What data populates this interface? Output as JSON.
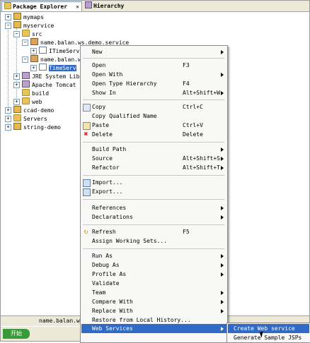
{
  "tabs": {
    "package_explorer": "Package Explorer",
    "hierarchy": "Hierarchy",
    "close": "✕"
  },
  "tree": {
    "mymaps": "mymaps",
    "myservice": "myservice",
    "src": "src",
    "pkg1": "name.balan.ws.demo.service",
    "file1": "ITimeServ",
    "pkg2": "name.balan.w",
    "file2": "TimeServ",
    "jre": "JRE System Libr",
    "tomcat": "Apache Tomcat v",
    "build": "build",
    "web": "web",
    "ccad": "ccad-demo",
    "servers": "Servers",
    "string": "string-demo"
  },
  "status": {
    "text": "name.balan.w",
    "start": "开始"
  },
  "menu": {
    "new": "New",
    "open": "Open",
    "open_acc": "F3",
    "open_with": "Open With",
    "open_type": "Open Type Hierarchy",
    "open_type_acc": "F4",
    "show_in": "Show In",
    "show_in_acc": "Alt+Shift+W",
    "copy": "Copy",
    "copy_acc": "Ctrl+C",
    "copy_q": "Copy Qualified Name",
    "paste": "Paste",
    "paste_acc": "Ctrl+V",
    "delete": "Delete",
    "delete_acc": "Delete",
    "build_path": "Build Path",
    "source": "Source",
    "source_acc": "Alt+Shift+S",
    "refactor": "Refactor",
    "refactor_acc": "Alt+Shift+T",
    "import": "Import...",
    "export": "Export...",
    "references": "References",
    "declarations": "Declarations",
    "refresh": "Refresh",
    "refresh_acc": "F5",
    "assign": "Assign Working Sets...",
    "run_as": "Run As",
    "debug_as": "Debug As",
    "profile_as": "Profile As",
    "validate": "Validate",
    "team": "Team",
    "compare": "Compare With",
    "replace": "Replace With",
    "restore": "Restore from Local History...",
    "web_services": "Web Services"
  },
  "submenu": {
    "create": "Create Web service",
    "generate": "Generate Sample JSPs"
  },
  "colors": {
    "highlight": "#316ac5",
    "menu_bg": "#f8f8f6"
  }
}
